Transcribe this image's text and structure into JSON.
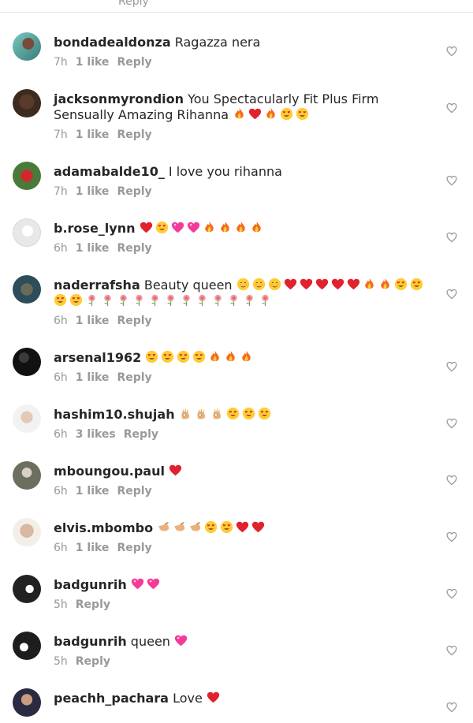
{
  "top_cut_text": "Reply",
  "comments": [
    {
      "username": "bondadealdonza",
      "text": "Ragazza nera",
      "emojis": [],
      "time": "7h",
      "likes": "1 like",
      "reply": "Reply"
    },
    {
      "username": "jacksonmyrondion",
      "text": "You Spectacularly Fit Plus Firm Sensually Amazing Rihanna",
      "emojis": [
        "fire",
        "red-heart",
        "fire",
        "heart-eyes",
        "heart-eyes"
      ],
      "time": "7h",
      "likes": "1 like",
      "reply": "Reply"
    },
    {
      "username": "adamabalde10_",
      "text": "I love you rihanna",
      "emojis": [],
      "time": "7h",
      "likes": "1 like",
      "reply": "Reply"
    },
    {
      "username": "b.rose_lynn",
      "text": "",
      "emojis": [
        "red-heart",
        "heart-eyes",
        "pink-heart",
        "pink-heart",
        "fire",
        "fire",
        "fire",
        "fire"
      ],
      "time": "6h",
      "likes": "1 like",
      "reply": "Reply"
    },
    {
      "username": "naderrafsha",
      "text": "Beauty queen",
      "emojis": [
        "blush",
        "blush",
        "blush",
        "red-heart",
        "red-heart",
        "red-heart",
        "red-heart",
        "red-heart",
        "fire",
        "fire",
        "heart-eyes",
        "heart-eyes",
        "heart-eyes",
        "heart-eyes",
        "rose",
        "rose",
        "rose",
        "rose",
        "rose",
        "rose",
        "rose",
        "rose",
        "rose",
        "rose",
        "rose",
        "rose"
      ],
      "time": "6h",
      "likes": "1 like",
      "reply": "Reply"
    },
    {
      "username": "arsenal1962",
      "text": "",
      "emojis": [
        "heart-eyes",
        "heart-eyes",
        "heart-eyes",
        "heart-eyes",
        "fire",
        "fire",
        "fire"
      ],
      "time": "6h",
      "likes": "1 like",
      "reply": "Reply"
    },
    {
      "username": "hashim10.shujah",
      "text": "",
      "emojis": [
        "ok-hand",
        "ok-hand",
        "ok-hand",
        "heart-eyes",
        "heart-eyes",
        "heart-eyes"
      ],
      "time": "6h",
      "likes": "3 likes",
      "reply": "Reply"
    },
    {
      "username": "mboungou.paul",
      "text": "",
      "emojis": [
        "red-heart"
      ],
      "time": "6h",
      "likes": "1 like",
      "reply": "Reply"
    },
    {
      "username": "elvis.mbombo",
      "text": "",
      "emojis": [
        "point",
        "point",
        "point",
        "heart-eyes",
        "heart-eyes",
        "red-heart",
        "red-heart"
      ],
      "time": "6h",
      "likes": "1 like",
      "reply": "Reply"
    },
    {
      "username": "badgunrih",
      "text": "",
      "emojis": [
        "pink-heart",
        "pink-heart"
      ],
      "time": "5h",
      "likes": "",
      "reply": "Reply"
    },
    {
      "username": "badgunrih",
      "text": "queen",
      "emojis": [
        "pink-heart"
      ],
      "time": "5h",
      "likes": "",
      "reply": "Reply"
    },
    {
      "username": "peachh_pachara",
      "text": "Love",
      "emojis": [
        "red-heart"
      ],
      "time": "",
      "likes": "",
      "reply": ""
    }
  ],
  "colors": {
    "text": "#262626",
    "meta": "#999999",
    "heart_outline": "#999999"
  }
}
